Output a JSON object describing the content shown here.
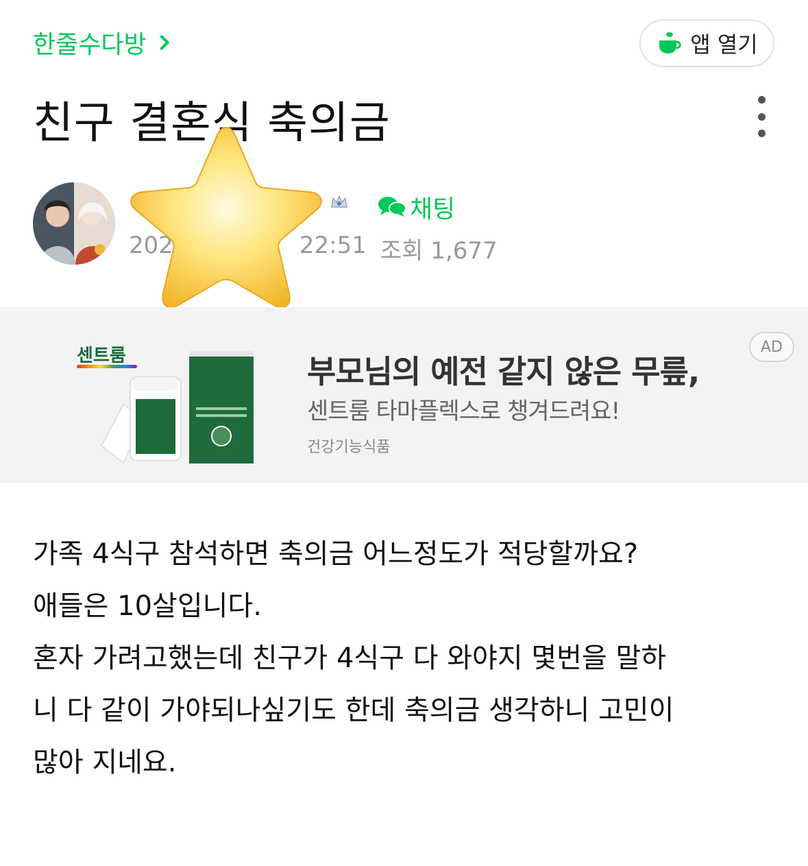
{
  "header": {
    "cafe_name": "한줄수다방",
    "app_open_label": "앱 열기"
  },
  "post": {
    "title": "친구 결혼식 축의금",
    "author": {
      "date_time": "22:51",
      "date_prefix": "202",
      "views_label": "조회 1,677",
      "chat_label": "채팅"
    },
    "body_lines": [
      "가족 4식구 참석하면 축의금 어느정도가 적당할까요?",
      "애들은 10살입니다.",
      "혼자 가려고했는데 친구가 4식구 다 와야지 몇번을 말하",
      "니 다 같이 가야되나싶기도 한데 축의금 생각하니 고민이",
      "많아 지네요."
    ]
  },
  "ad": {
    "brand": "센트룸",
    "headline": "부모님의 예전 같지 않은 무릎,",
    "subline": "센트룸 타마플렉스로 챙겨드려요!",
    "category": "건강기능식품",
    "badge": "AD"
  },
  "icons": {
    "menu": "kebab-menu-icon",
    "app": "cup-icon",
    "chat": "chat-bubble-icon",
    "grade": "crown-grade-icon",
    "overlay": "star-emoji"
  },
  "colors": {
    "accent": "#03c75a",
    "ad_bg": "#f3f3f4",
    "meta": "#999999"
  }
}
